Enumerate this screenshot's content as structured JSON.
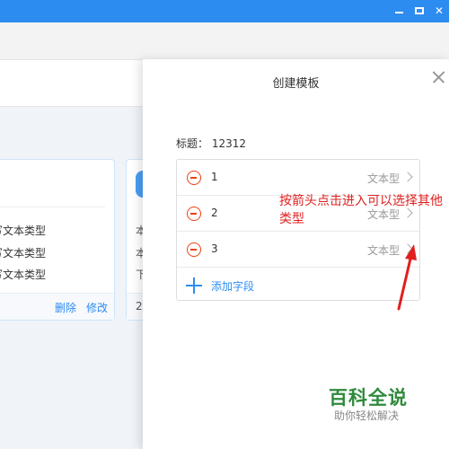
{
  "background": {
    "card_lines": [
      "写文本类型",
      "写文本类型",
      "写文本类型"
    ],
    "card_actions": {
      "delete": "删除",
      "edit": "修改"
    },
    "mid_card_chars": [
      "本",
      "本",
      "下",
      "2"
    ]
  },
  "modal": {
    "title": "创建模板",
    "field_title": "标题： 12312",
    "fields": [
      {
        "name": "1",
        "type": "文本型"
      },
      {
        "name": "2",
        "type": "文本型"
      },
      {
        "name": "3",
        "type": "文本型"
      }
    ],
    "add_field": "添加字段"
  },
  "annotation": "按箭头点击进入可以选择其他类型",
  "watermark": {
    "main": "百科全说",
    "sub": "助你轻松解决"
  },
  "colors": {
    "accent": "#2d8cf0",
    "danger": "#ed4014",
    "annotation": "#e02020",
    "watermark": "#2f8a3c"
  }
}
